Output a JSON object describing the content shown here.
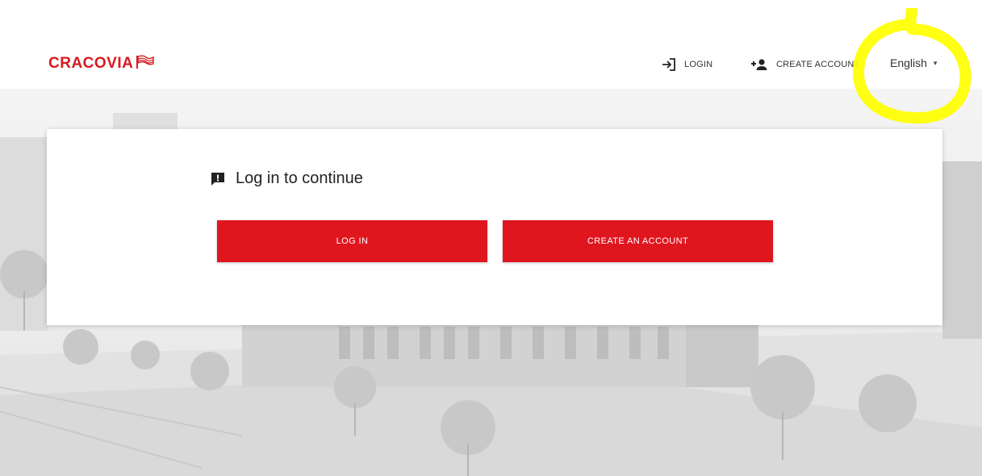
{
  "brand": {
    "name": "CRACOVIA",
    "color": "#d71920",
    "flag_icon": "flag-icon"
  },
  "nav": {
    "login_label": "LOGIN",
    "login_icon": "login-arrow-icon",
    "create_account_label": "CREATE ACCOUNT",
    "create_account_icon": "add-user-icon",
    "language_label": "English",
    "language_caret": "▾"
  },
  "card": {
    "title": "Log in to continue",
    "title_icon": "alert-message-icon",
    "login_button_label": "LOG IN",
    "create_button_label": "CREATE AN ACCOUNT",
    "button_color": "#e0161f"
  },
  "annotation": {
    "highlight_color": "#ffff00"
  }
}
